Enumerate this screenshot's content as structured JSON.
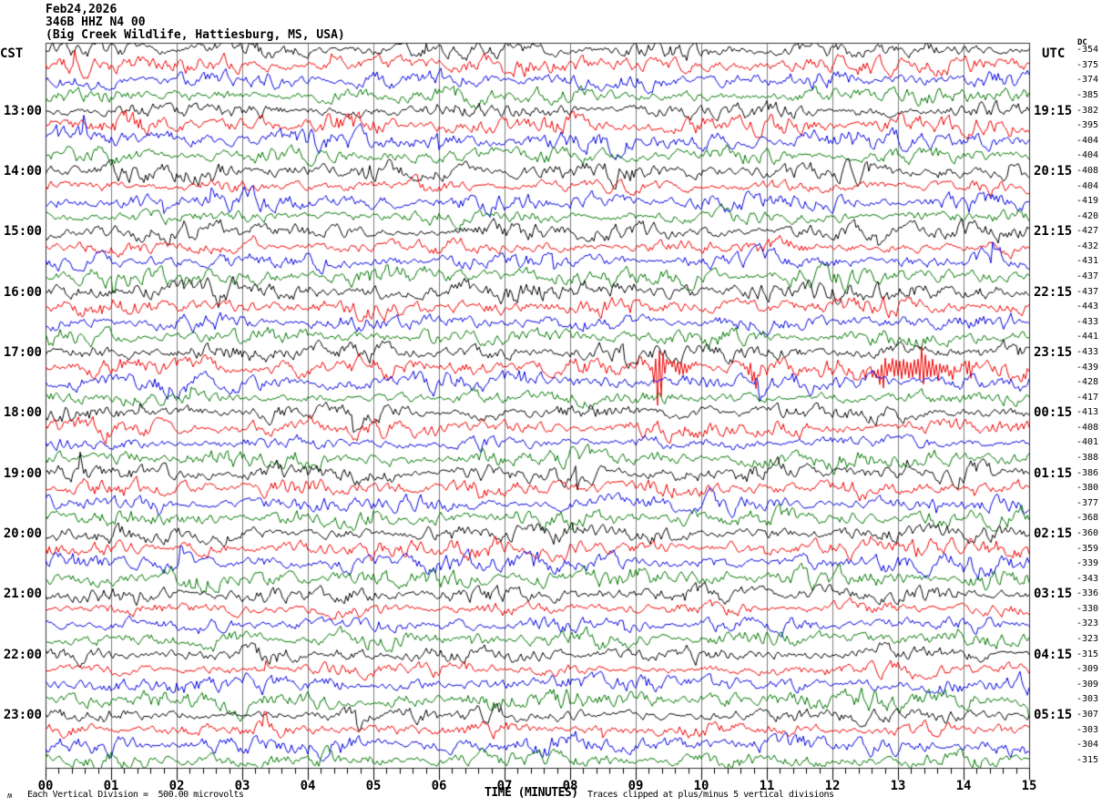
{
  "header": {
    "date": "Feb24,2026",
    "station_line": "346B HHZ N4 00",
    "location_line": "(Big Creek Wildlife, Hattiesburg, MS, USA)"
  },
  "axes": {
    "left_timezone_label": "CST",
    "right_timezone_label": "UTC",
    "dc_column_label": "DC",
    "x_axis_label": "TIME (MINUTES)",
    "x_tick_labels": [
      "00",
      "01",
      "02",
      "03",
      "04",
      "05",
      "06",
      "07",
      "08",
      "09",
      "10",
      "11",
      "12",
      "13",
      "14",
      "15"
    ],
    "left_hour_labels": [
      "13:00",
      "14:00",
      "15:00",
      "16:00",
      "17:00",
      "18:00",
      "19:00",
      "20:00",
      "21:00",
      "22:00",
      "23:00"
    ],
    "right_hour_labels": [
      "19:15",
      "20:15",
      "21:15",
      "22:15",
      "23:15",
      "00:15",
      "01:15",
      "02:15",
      "03:15",
      "04:15",
      "05:15"
    ]
  },
  "footer": {
    "watermark": "ʍ",
    "scale_note": "Each Vertical Division =  500.00 microvolts",
    "clip_note": "Traces clipped at plus/minus 5 vertical divisions"
  },
  "chart_data": {
    "type": "line",
    "subtype": "helicorder-seismogram",
    "title": "346B HHZ N4 00 (Big Creek Wildlife, Hattiesburg, MS, USA) Feb24,2026",
    "xlabel": "TIME (MINUTES)",
    "x_range_minutes": [
      0,
      15
    ],
    "rows": 48,
    "traces_per_hour": 4,
    "minutes_per_row": 15,
    "hour_label_row_indices": [
      4,
      8,
      12,
      16,
      20,
      24,
      28,
      32,
      36,
      40,
      44
    ],
    "row_color_cycle": [
      "#000000",
      "#ee0000",
      "#0000dd",
      "#007700"
    ],
    "grid_color": "#7d7d7d",
    "frame_color": "#333333",
    "background": "#ffffff",
    "volts_per_division": "500.00 microvolts",
    "clip_limit_divisions": 5,
    "noise_amplitude_divisions": 0.9,
    "minor_ticks_per_minute": 5,
    "dc_offsets": [
      -354,
      -375,
      -374,
      -385,
      -382,
      -395,
      -404,
      -404,
      -408,
      -404,
      -419,
      -420,
      -427,
      -432,
      -431,
      -437,
      -437,
      -443,
      -433,
      -441,
      -433,
      -439,
      -428,
      -417,
      -413,
      -408,
      -401,
      -388,
      -386,
      -380,
      -377,
      -368,
      -360,
      -359,
      -339,
      -343,
      -336,
      -330,
      -323,
      -323,
      -315,
      -309,
      -309,
      -303,
      -307,
      -303,
      -304,
      -315
    ],
    "events": [
      {
        "row": 21,
        "minute": 9.35,
        "sigma_minutes": 0.05,
        "amplitude_divisions": 5.5,
        "note": "large clipped burst"
      },
      {
        "row": 21,
        "minute": 9.6,
        "sigma_minutes": 0.22,
        "amplitude_divisions": 0.9,
        "note": "coda"
      },
      {
        "row": 21,
        "minute": 10.8,
        "sigma_minutes": 0.09,
        "amplitude_divisions": 1.2
      },
      {
        "row": 21,
        "minute": 12.78,
        "sigma_minutes": 0.05,
        "amplitude_divisions": 2.4
      },
      {
        "row": 21,
        "minute": 13.05,
        "sigma_minutes": 0.06,
        "amplitude_divisions": 1.9
      },
      {
        "row": 21,
        "minute": 13.2,
        "sigma_minutes": 0.45,
        "amplitude_divisions": 1.3,
        "note": "sustained burst"
      },
      {
        "row": 21,
        "minute": 13.38,
        "sigma_minutes": 0.05,
        "amplitude_divisions": 3.0
      },
      {
        "row": 21,
        "minute": 13.6,
        "sigma_minutes": 0.05,
        "amplitude_divisions": 1.7
      },
      {
        "row": 21,
        "minute": 14.07,
        "sigma_minutes": 0.04,
        "amplitude_divisions": 1.6
      }
    ]
  }
}
